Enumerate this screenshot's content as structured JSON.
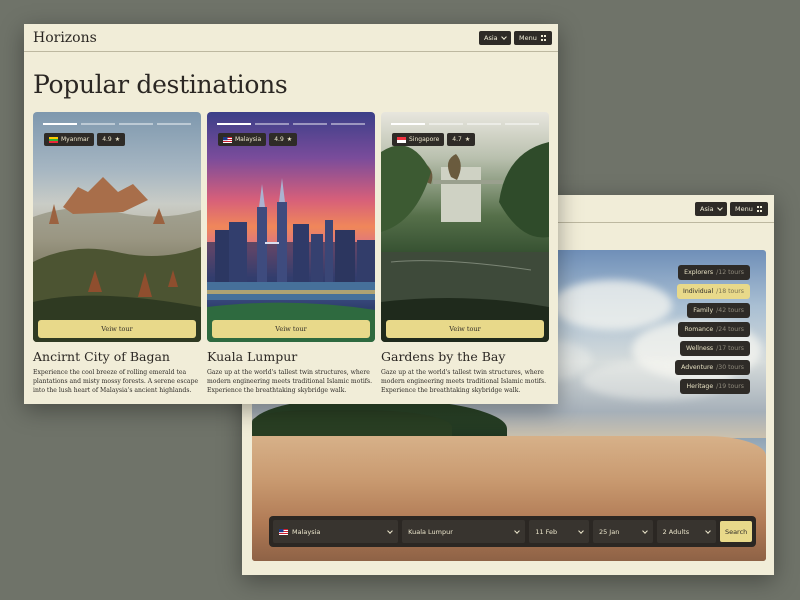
{
  "back_window": {
    "region_select": "Asia",
    "menu_label": "Menu",
    "tour_categories": [
      {
        "name": "Explorers",
        "count": "/12 tours",
        "active": false
      },
      {
        "name": "Individual",
        "count": "/18 tours",
        "active": true
      },
      {
        "name": "Family",
        "count": "/42 tours",
        "active": false
      },
      {
        "name": "Romance",
        "count": "/24 tours",
        "active": false
      },
      {
        "name": "Wellness",
        "count": "/17 tours",
        "active": false
      },
      {
        "name": "Adventure",
        "count": "/30 tours",
        "active": false
      },
      {
        "name": "Heritage",
        "count": "/19 tours",
        "active": false
      }
    ],
    "search": {
      "country": "Malaysia",
      "city": "Kuala Lumpur",
      "date_from": "11 Feb",
      "date_to": "25 Jan",
      "guests": "2 Adults",
      "button": "Search"
    }
  },
  "front_window": {
    "brand": "Horizons",
    "region_select": "Asia",
    "menu_label": "Menu",
    "title": "Popular destinations",
    "cards": [
      {
        "country": "Myanmar",
        "rating": "4.9",
        "button": "Veiw tour",
        "name": "Ancirnt City of Bagan",
        "description": "Experience the cool breeze of rolling emerald tea plantations and misty mossy forests. A serene escape into the lush heart of Malaysia's ancient highlands."
      },
      {
        "country": "Malaysia",
        "rating": "4.9",
        "button": "Veiw tour",
        "name": "Kuala Lumpur",
        "description": "Gaze up at the world's tallest twin structures, where modern engineering meets traditional Islamic motifs. Experience the breathtaking skybridge walk."
      },
      {
        "country": "Singapore",
        "rating": "4.7",
        "button": "Veiw tour",
        "name": "Gardens by the Bay",
        "description": "Gaze up at the world's tallest twin structures, where modern engineering meets traditional Islamic motifs. Experience the breathtaking skybridge walk."
      }
    ]
  },
  "icons": {
    "star": "star-icon",
    "chevron": "chevron-down-icon",
    "menu_grid": "grid-icon"
  },
  "colors": {
    "background": "#6f7369",
    "panel": "#f1edd8",
    "dark": "#2e2b27",
    "accent": "#e8d98a"
  }
}
